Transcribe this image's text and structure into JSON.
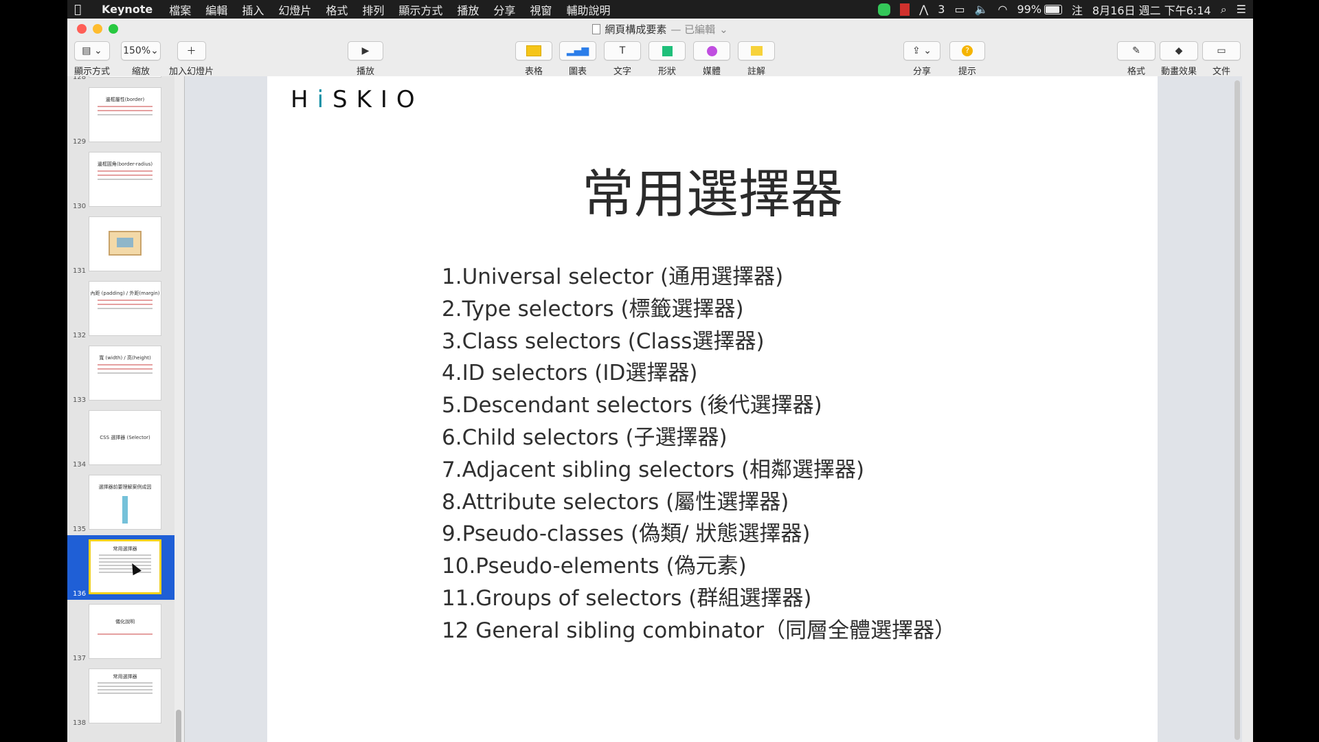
{
  "menubar": {
    "app": "Keynote",
    "items": [
      "檔案",
      "編輯",
      "插入",
      "幻燈片",
      "格式",
      "排列",
      "顯示方式",
      "播放",
      "分享",
      "視窗",
      "輔助說明"
    ],
    "badge": "3",
    "battery": "99%",
    "battery_level": 0.99,
    "input_method": "注",
    "clock": "8月16日 週二 下午6:14"
  },
  "window": {
    "title": "網頁構成要素",
    "title_status": "— 已編輯"
  },
  "toolbar": {
    "view_label": "顯示方式",
    "zoom_value": "150%",
    "zoom_label": "縮放",
    "add_slide_label": "加入幻燈片",
    "play_label": "播放",
    "table_label": "表格",
    "chart_label": "圖表",
    "text_label": "文字",
    "shape_label": "形狀",
    "media_label": "媒體",
    "comment_label": "註解",
    "share_label": "分享",
    "tips_label": "提示",
    "format_label": "格式",
    "animate_label": "動畫效果",
    "document_label": "文件"
  },
  "navigator": {
    "slides": [
      {
        "num": "128",
        "title": ""
      },
      {
        "num": "129",
        "title": "邊框屬性(border)"
      },
      {
        "num": "130",
        "title": "邊框圓角(border-radius)"
      },
      {
        "num": "131",
        "title": ""
      },
      {
        "num": "132",
        "title": "內距 (padding) / 外距(margin)"
      },
      {
        "num": "133",
        "title": "寬 (width) / 高(height)"
      },
      {
        "num": "134",
        "title": "CSS 選擇器 (Selector)"
      },
      {
        "num": "135",
        "title": "選擇器前要理解案例成因"
      },
      {
        "num": "136",
        "title": "常用選擇器"
      },
      {
        "num": "137",
        "title": "儀化說明"
      },
      {
        "num": "138",
        "title": "常用選擇器"
      }
    ],
    "selected": "136"
  },
  "slide": {
    "logo_prefix": "H",
    "logo_accent": "i",
    "logo_rest": "SKIO",
    "title": "常用選擇器",
    "items": [
      "1.Universal selector (通用選擇器)",
      "2.Type selectors (標籤選擇器)",
      "3.Class selectors (Class選擇器)",
      "4.ID selectors (ID選擇器)",
      "5.Descendant selectors (後代選擇器)",
      "6.Child selectors (子選擇器)",
      "7.Adjacent sibling selectors (相鄰選擇器)",
      "8.Attribute selectors (屬性選擇器)",
      "9.Pseudo-classes (偽類/ 狀態選擇器)",
      "10.Pseudo-elements (偽元素)",
      "11.Groups of selectors (群組選擇器)",
      "12 General sibling combinator（同層全體選擇器）"
    ]
  },
  "colors": {
    "selection": "#1f5fd6",
    "thumb_highlight": "#f6d21b",
    "logo_accent": "#0f8fa5"
  },
  "icons": {
    "apple": "apple-icon",
    "wifi": "wifi-icon",
    "volume": "volume-icon",
    "search": "search-icon",
    "menu": "list-icon"
  }
}
